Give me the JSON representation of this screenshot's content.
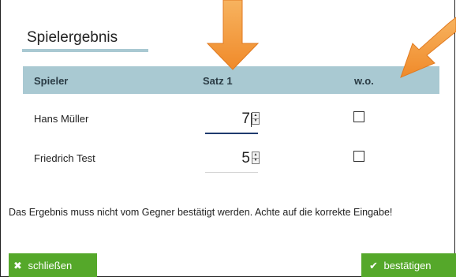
{
  "dialog": {
    "title": "Spielergebnis",
    "columns": {
      "player": "Spieler",
      "set": "Satz 1",
      "walkover": "w.o."
    },
    "rows": [
      {
        "player": "Hans Müller",
        "score": "7",
        "walkover": false
      },
      {
        "player": "Friedrich Test",
        "score": "5",
        "walkover": false
      }
    ],
    "note": "Das Ergebnis muss nicht vom Gegner bestätigt werden. Achte auf die korrekte Eingabe!",
    "buttons": {
      "close": {
        "label": "schließen",
        "icon": "close-x-icon"
      },
      "confirm": {
        "label": "bestätigen",
        "icon": "checkmark-icon"
      }
    }
  },
  "colors": {
    "header_bg": "#a9c9d2",
    "button_green": "#55a82a",
    "arrow_orange": "#f5a24a",
    "focus_underline": "#1f3b6e"
  }
}
